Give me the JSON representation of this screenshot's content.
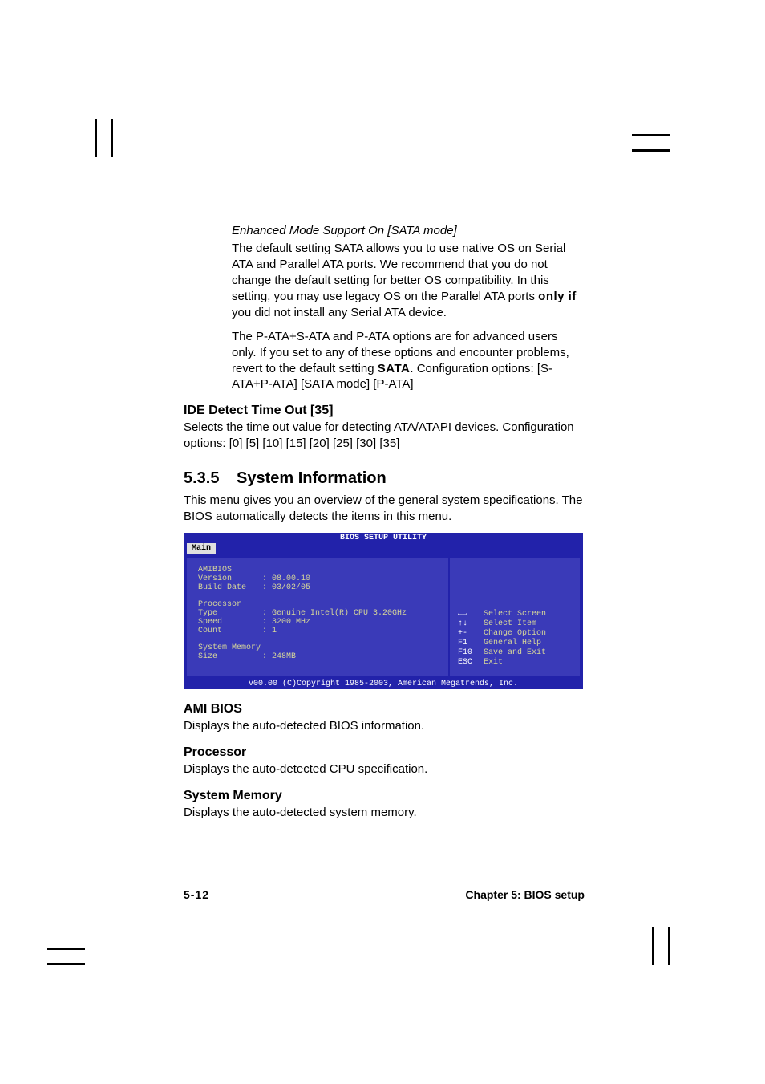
{
  "section1": {
    "heading_ital": "Enhanced Mode Support On [SATA mode]",
    "para1a": "The default setting SATA allows you to use native OS on Serial ATA and Parallel ATA ports. We recommend that you do not change the default setting for better OS compatibility. In this setting, you may use legacy OS on the Parallel ATA ports ",
    "para1_bold": "only if",
    "para1b": " you did not install any Serial ATA device.",
    "para2a": "The P-ATA+S-ATA and P-ATA options are for advanced users only. If you set to any of these options and encounter problems, revert to the default setting ",
    "para2_bold": "SATA",
    "para2b": ". Configuration options: [S-ATA+P-ATA] [SATA mode] [P-ATA]"
  },
  "ide": {
    "heading": "IDE Detect Time Out [35]",
    "p1": "Selects the time out value for detecting ATA/ATAPI devices. Configuration options: [0] [5] [10] [15] [20] [25] [30] [35]"
  },
  "sysinfo": {
    "secno": "5.3.5",
    "title": "System Information",
    "intro": "This menu gives you an overview of the general system specifications. The BIOS automatically detects the items in this menu."
  },
  "bios": {
    "title": "BIOS SETUP UTILITY",
    "tab": "Main",
    "ami_label": "AMIBIOS",
    "version_l": "Version",
    "version_v": ": 08.00.10",
    "build_l": "Build Date",
    "build_v": ": 03/02/05",
    "proc_label": "Processor",
    "type_l": "Type",
    "type_v": ": Genuine Intel(R) CPU 3.20GHz",
    "speed_l": "Speed",
    "speed_v": ": 3200 MHz",
    "count_l": "Count",
    "count_v": ": 1",
    "mem_label": "System Memory",
    "size_l": "Size",
    "size_v": ": 248MB",
    "help": {
      "r1k": "←→",
      "r1v": "Select Screen",
      "r2k": "↑↓",
      "r2v": "Select Item",
      "r3k": "+-",
      "r3v": "Change Option",
      "r4k": "F1",
      "r4v": "General Help",
      "r5k": "F10",
      "r5v": "Save and Exit",
      "r6k": "ESC",
      "r6v": "Exit"
    },
    "footer": "v00.00 (C)Copyright 1985-2003, American Megatrends, Inc."
  },
  "defs": {
    "ami_h": "AMI BIOS",
    "ami_p": "Displays the auto-detected BIOS information.",
    "proc_h": "Processor",
    "proc_p": "Displays the auto-detected CPU specification.",
    "mem_h": "System Memory",
    "mem_p": "Displays the auto-detected system memory."
  },
  "footer": {
    "page": "5-12",
    "chapter": "Chapter 5: BIOS setup"
  }
}
